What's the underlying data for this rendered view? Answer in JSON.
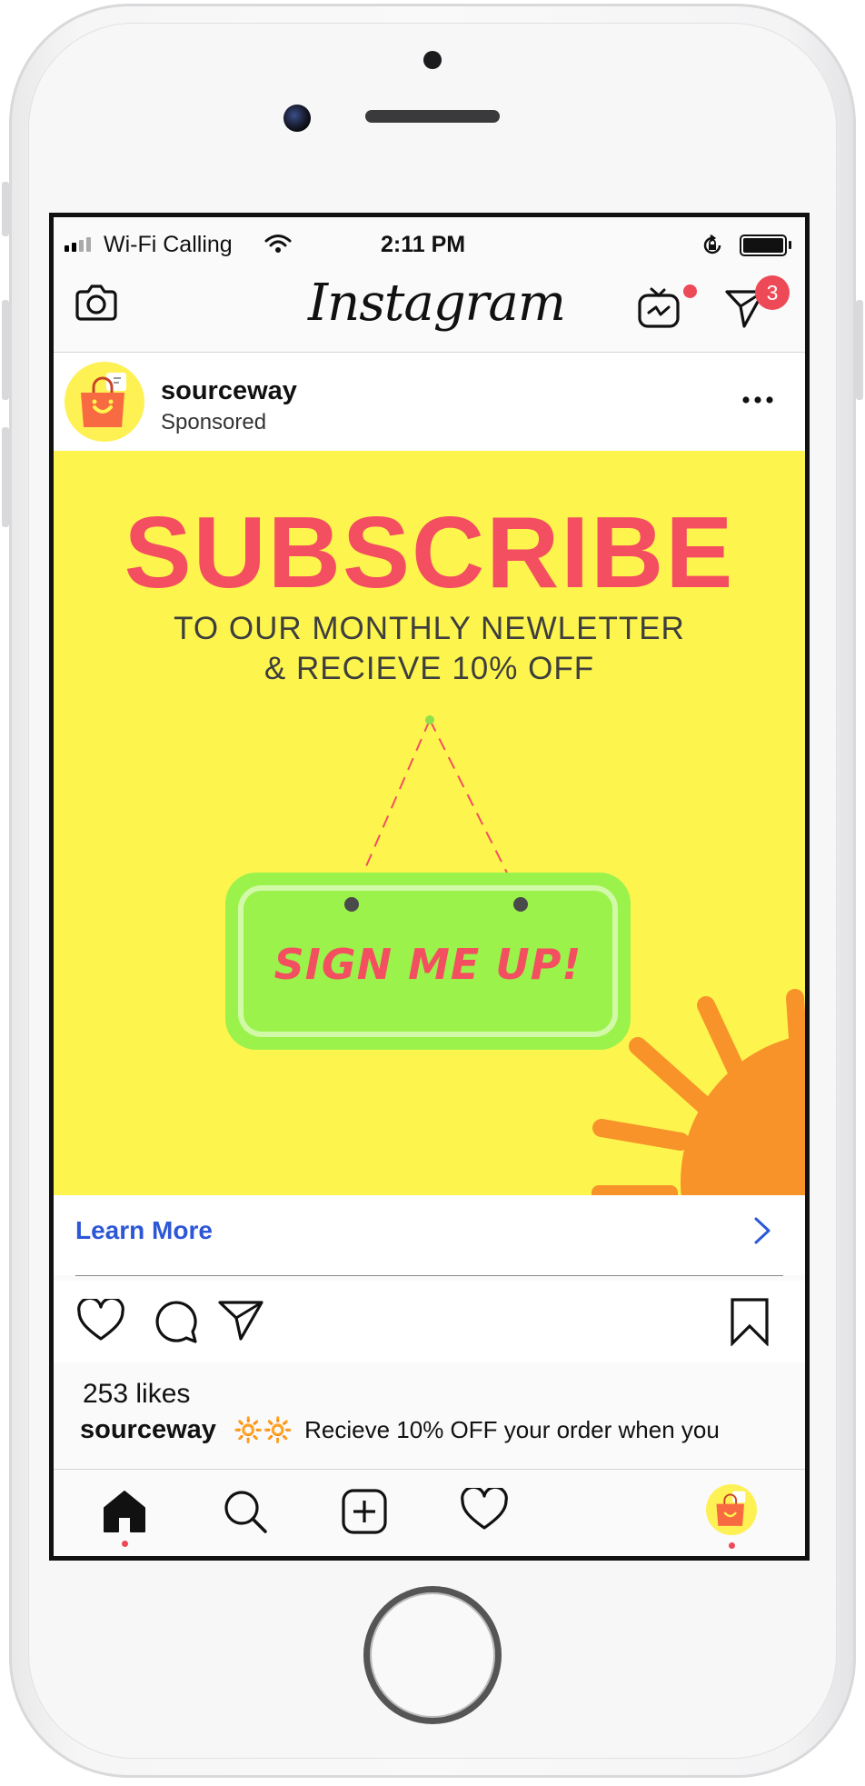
{
  "status_bar": {
    "carrier": "Wi-Fi Calling",
    "time": "2:11 PM",
    "signal_bars": 2,
    "battery_level": 0.9
  },
  "header": {
    "logo": "Instagram",
    "camera_icon": "camera-icon",
    "igtv_icon": "igtv-icon",
    "direct_icon": "paper-plane-icon",
    "direct_badge": "3"
  },
  "post": {
    "username": "sourceway",
    "label": "Sponsored",
    "more_icon": "more-horizontal-icon"
  },
  "ad": {
    "title": "SUBSCRIBE",
    "subtitle_line1": "TO OUR MONTHLY NEWLETTER",
    "subtitle_line2": "& RECIEVE 10% OFF",
    "button_label": "SIGN ME UP!",
    "colors": {
      "background": "#fdf54e",
      "title": "#f44e61",
      "button": "#9af24b",
      "sun": "#f8932a"
    }
  },
  "cta": {
    "label": "Learn More",
    "arrow_icon": "chevron-right-icon",
    "color": "#2d57d6"
  },
  "actions": {
    "like_icon": "heart-icon",
    "comment_icon": "comment-icon",
    "share_icon": "paper-plane-icon",
    "save_icon": "bookmark-icon"
  },
  "likes": "253 likes",
  "caption": {
    "username": "sourceway",
    "emoji": "🔆🔆",
    "text": "Recieve 10% OFF your order when you"
  },
  "tabbar": {
    "items": [
      "home-icon",
      "search-icon",
      "add-post-icon",
      "heart-icon",
      "profile-avatar"
    ]
  }
}
